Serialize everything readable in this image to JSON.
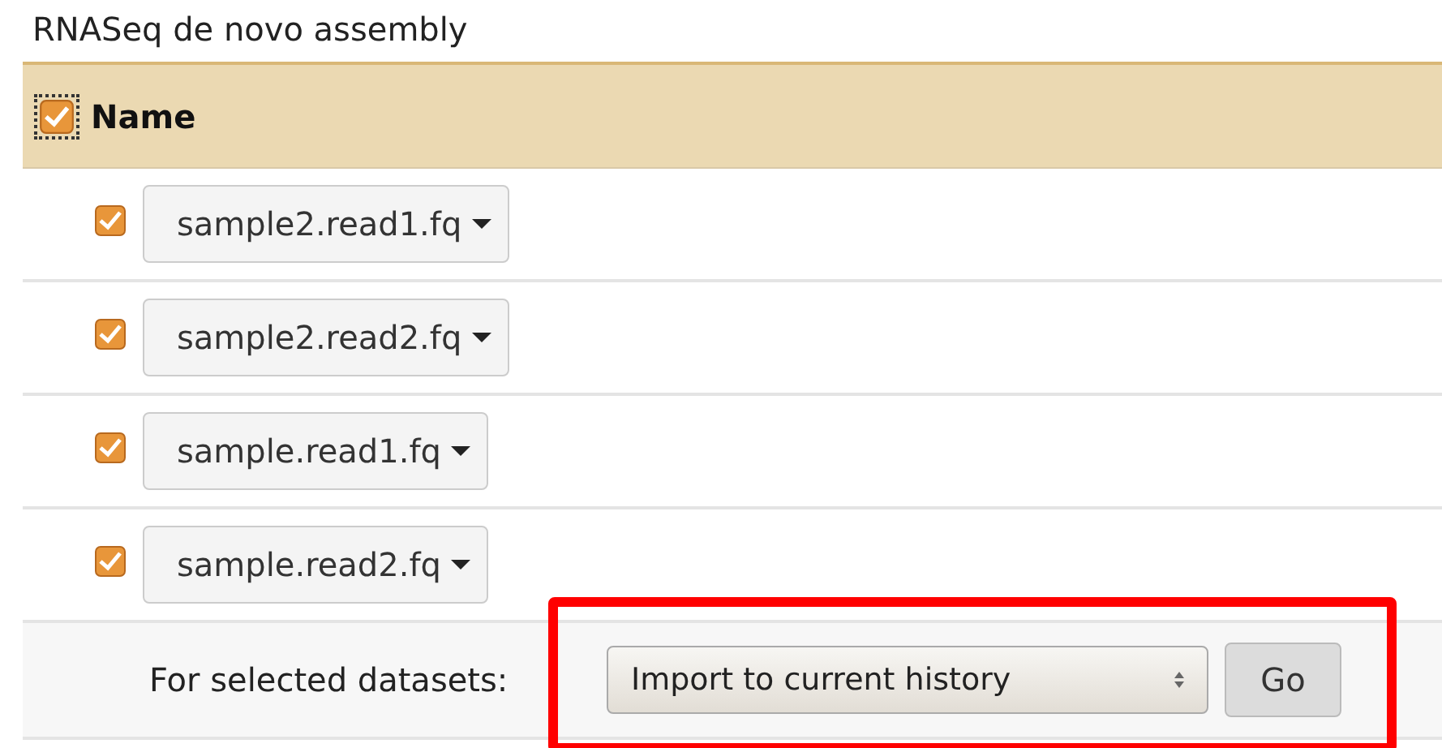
{
  "title": "RNASeq de novo assembly",
  "header": {
    "label": "Name",
    "checked": true
  },
  "datasets": [
    {
      "name": "sample2.read1.fq",
      "checked": true
    },
    {
      "name": "sample2.read2.fq",
      "checked": true
    },
    {
      "name": "sample.read1.fq",
      "checked": true
    },
    {
      "name": "sample.read2.fq",
      "checked": true
    }
  ],
  "footer": {
    "label": "For selected datasets:",
    "action": "Import to current history",
    "button": "Go"
  },
  "highlight": true
}
